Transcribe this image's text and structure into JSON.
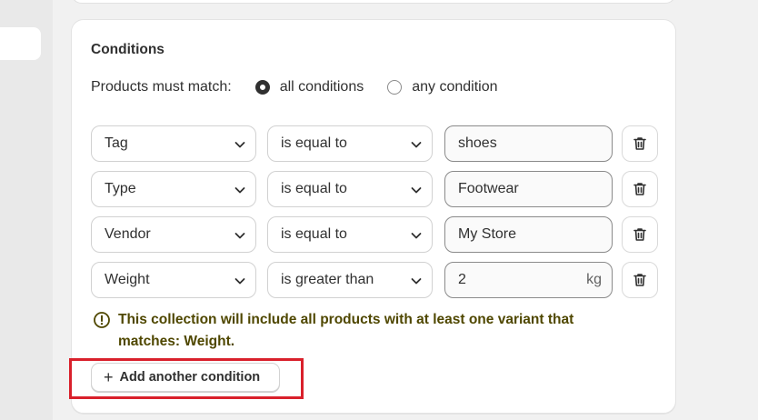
{
  "card": {
    "title": "Conditions"
  },
  "match": {
    "label": "Products must match:",
    "options": [
      {
        "label": "all conditions",
        "checked": true
      },
      {
        "label": "any condition",
        "checked": false
      }
    ]
  },
  "conditions": [
    {
      "field": "Tag",
      "operator": "is equal to",
      "value": "shoes",
      "suffix": ""
    },
    {
      "field": "Type",
      "operator": "is equal to",
      "value": "Footwear",
      "suffix": ""
    },
    {
      "field": "Vendor",
      "operator": "is equal to",
      "value": "My Store",
      "suffix": ""
    },
    {
      "field": "Weight",
      "operator": "is greater than",
      "value": "2",
      "suffix": "kg"
    }
  ],
  "warning": {
    "line1": "This collection will include all products with at least one variant that",
    "line2": "matches: Weight."
  },
  "add_button": {
    "label": "Add another condition",
    "icon": "plus-icon"
  },
  "colors": {
    "warning_text": "#4f4700",
    "highlight": "#d9202b"
  }
}
